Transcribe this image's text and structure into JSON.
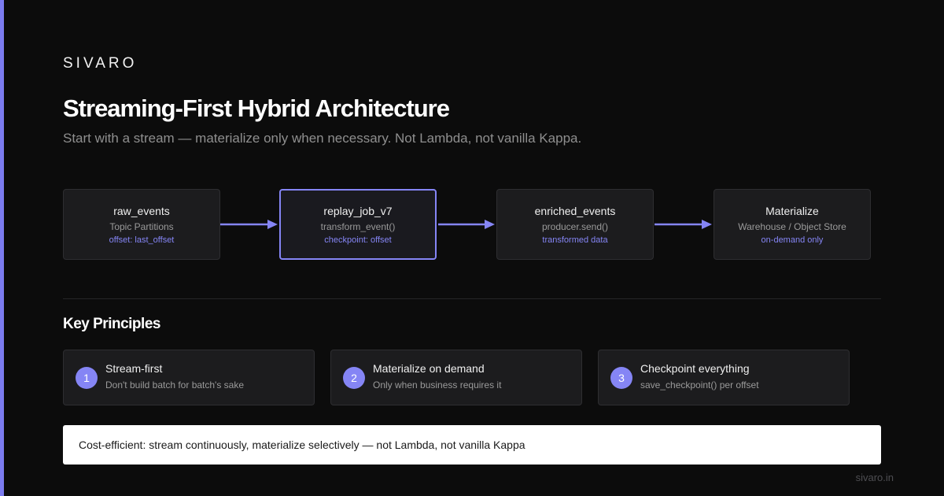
{
  "brand": "SIVARO",
  "title": "Streaming-First Hybrid Architecture",
  "subtitle": "Start with a stream — materialize only when necessary. Not Lambda, not vanilla Kappa.",
  "colors": {
    "accent": "#8585f5",
    "background": "#0c0c0c",
    "card": "#1c1c1e"
  },
  "pipeline": [
    {
      "title": "raw_events",
      "sub": "Topic Partitions",
      "note": "offset: last_offset"
    },
    {
      "title": "replay_job_v7",
      "sub": "transform_event()",
      "note": "checkpoint: offset",
      "highlighted": true
    },
    {
      "title": "enriched_events",
      "sub": "producer.send()",
      "note": "transformed data"
    },
    {
      "title": "Materialize",
      "sub": "Warehouse / Object Store",
      "note": "on-demand only"
    }
  ],
  "principles": {
    "heading": "Key Principles",
    "items": [
      {
        "number": "1",
        "title": "Stream-first",
        "desc": "Don't build batch for batch's sake"
      },
      {
        "number": "2",
        "title": "Materialize on demand",
        "desc": "Only when business requires it"
      },
      {
        "number": "3",
        "title": "Checkpoint everything",
        "desc": "save_checkpoint() per offset"
      }
    ]
  },
  "callout": "Cost-efficient: stream continuously, materialize selectively — not Lambda, not vanilla Kappa",
  "footer": "sivaro.in"
}
